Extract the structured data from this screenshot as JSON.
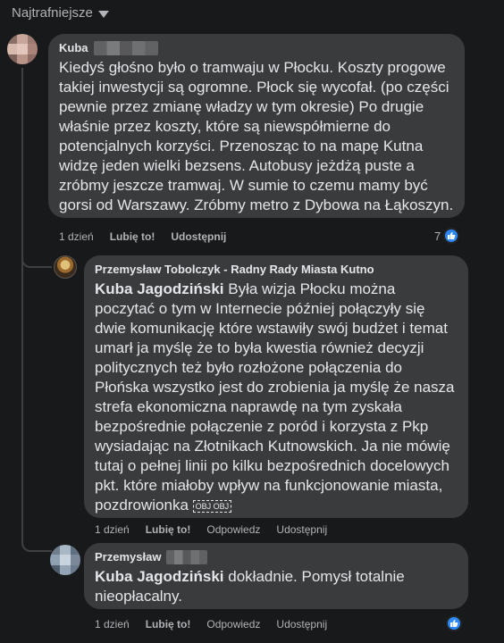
{
  "sort_label": "Najtrafniejsze",
  "comments": [
    {
      "author": "Kuba",
      "text": "Kiedyś głośno było o tramwaju w Płocku. Koszty progowe takiej inwestycji są ogromne. Płock się wycofał. (po części pewnie przez zmianę władzy w tym okresie) Po drugie właśnie przez koszty, które są niewspółmierne do potencjalnych korzyści. Przenosząc to na mapę Kutna widzę jeden wielki bezsens. Autobusy jeżdżą puste a zróbmy jeszcze tramwaj. W sumie to czemu mamy być gorsi od Warszawy. Zróbmy metro z Dybowa na Łąkoszyn.",
      "time": "1 dzień",
      "like": "Lubię to!",
      "share": "Udostępnij",
      "reaction_count": "7"
    },
    {
      "author": "Przemysław Tobolczyk - Radny Rady Miasta Kutno",
      "mention": "Kuba Jagodziński",
      "text": "Była wizja Płocku można poczytać o tym w Internecie później połączyły się dwie komunikację które wstawiły swój budżet i temat umarł ja myślę że to była kwestia również decyzji politycznych też było rozłożone połączenia do Płońska wszystko jest do zrobienia ja myślę że nasza strefa ekonomiczna naprawdę na tym zyskała bezpośrednie połączenie z poród i korzysta z Pkp wysiadając na Złotnikach Kutnowskich. Ja nie mówię tutaj o pełnej linii po kilku bezpośrednich docelowych pkt. które miałoby wpływ na funkcjonowanie miasta, pozdrowionka",
      "emoji": "OBJ OBJ",
      "time": "1 dzień",
      "like": "Lubię to!",
      "reply": "Odpowiedz",
      "share": "Udostępnij"
    },
    {
      "author": "Przemysław",
      "mention": "Kuba Jagodziński",
      "text": "dokładnie. Pomysł totalnie nieopłacalny.",
      "time": "1 dzień",
      "like": "Lubię to!",
      "reply": "Odpowiedz",
      "share": "Udostępnij"
    }
  ],
  "icons": {
    "sort": "chevron-down-icon",
    "reaction": "thumbs-up-icon"
  },
  "colors": {
    "bg": "#18191a",
    "bubble": "#3a3b3c",
    "text": "#e4e6eb",
    "muted": "#b0b3b8",
    "like": "#2d88ff"
  }
}
